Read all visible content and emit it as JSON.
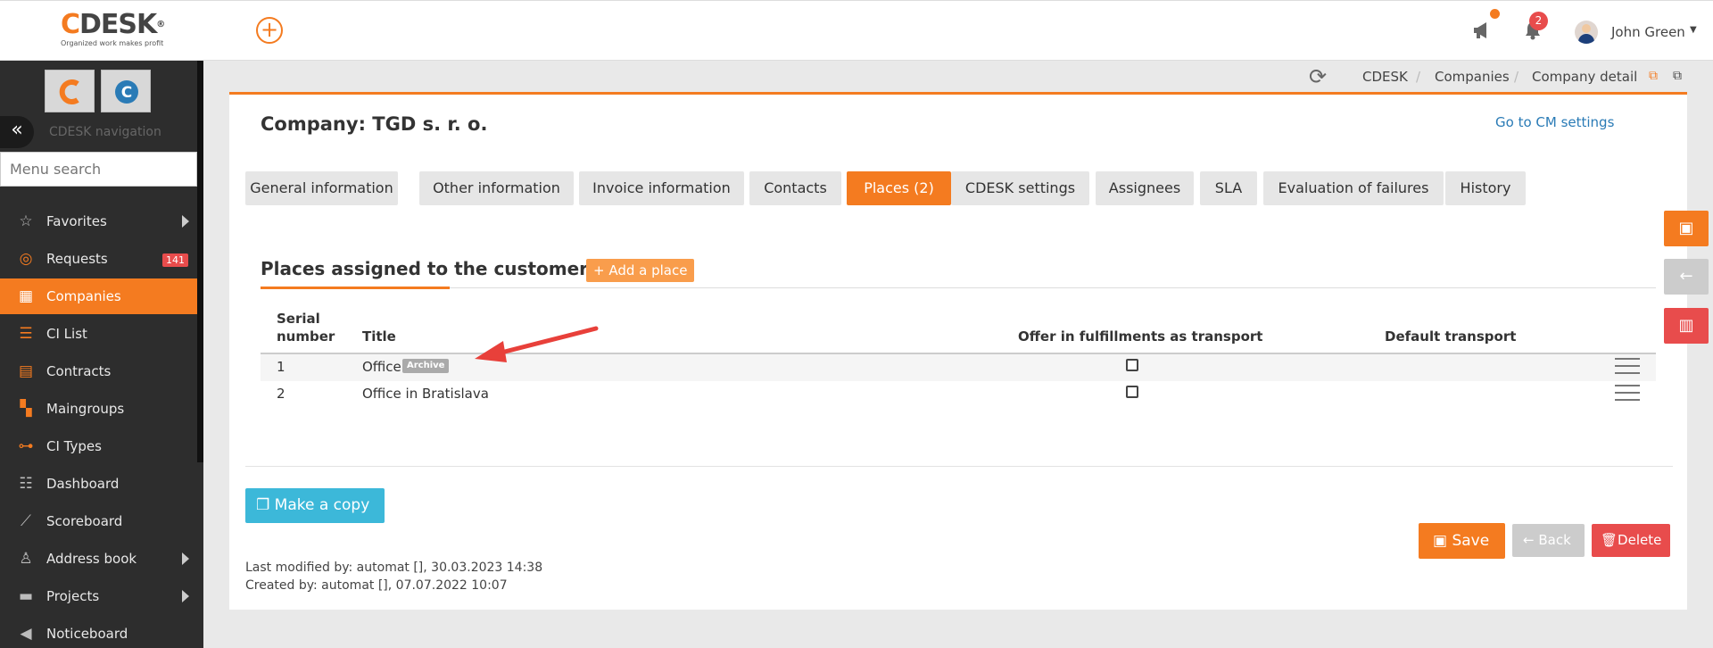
{
  "topbar": {
    "logo_main": "DESK",
    "logo_mark": "C",
    "logo_tagline": "Organized work makes profit",
    "notif_count": "2",
    "user_name": "John Green"
  },
  "sidebar": {
    "nav_label": "CDESK navigation",
    "search_placeholder": "Menu search",
    "items": [
      {
        "label": "Favorites",
        "icon": "star-icon"
      },
      {
        "label": "Requests",
        "icon": "requests-icon",
        "badge": "141"
      },
      {
        "label": "Companies",
        "icon": "building-icon"
      },
      {
        "label": "CI List",
        "icon": "list-icon"
      },
      {
        "label": "Contracts",
        "icon": "contract-icon"
      },
      {
        "label": "Maingroups",
        "icon": "maingroup-icon"
      },
      {
        "label": "CI Types",
        "icon": "ci-types-icon"
      },
      {
        "label": "Dashboard",
        "icon": "dashboard-icon"
      },
      {
        "label": "Scoreboard",
        "icon": "chart-icon"
      },
      {
        "label": "Address book",
        "icon": "user-icon"
      },
      {
        "label": "Projects",
        "icon": "projects-icon"
      },
      {
        "label": "Noticeboard",
        "icon": "megaphone-icon"
      }
    ]
  },
  "breadcrumb": {
    "items": [
      "CDESK",
      "Companies",
      "Company detail"
    ]
  },
  "page": {
    "title": "Company: TGD s. r. o.",
    "cm_link": "Go to CM settings",
    "tabs": [
      "General information",
      "Other information",
      "Invoice information",
      "Contacts",
      "Places (2)",
      "CDESK settings",
      "Assignees",
      "SLA",
      "Evaluation of failures",
      "History"
    ],
    "active_tab": "Places (2)"
  },
  "places": {
    "section_title": "Places assigned to the customer",
    "add_label": "Add a place",
    "columns": {
      "serial_1": "Serial",
      "serial_2": "number",
      "title": "Title",
      "offer": "Offer in fulfillments as transport",
      "default": "Default transport"
    },
    "rows": [
      {
        "serial": "1",
        "title": "Office",
        "badge": "Archive",
        "offer_checked": false
      },
      {
        "serial": "2",
        "title": "Office in Bratislava",
        "badge": "",
        "offer_checked": false
      }
    ]
  },
  "actions": {
    "copy": "Make a copy",
    "save": "Save",
    "back": "Back",
    "delete": "Delete"
  },
  "meta": {
    "modified": "Last modified by: automat  [], 30.03.2023 14:38",
    "created": "Created by: automat  [], 07.07.2022 10:07"
  },
  "colors": {
    "accent": "#f47b20",
    "sidebar_bg": "#2d2d2d",
    "copy_btn": "#3cb8d9",
    "danger": "#e84c4c",
    "link": "#2a7bb6"
  }
}
